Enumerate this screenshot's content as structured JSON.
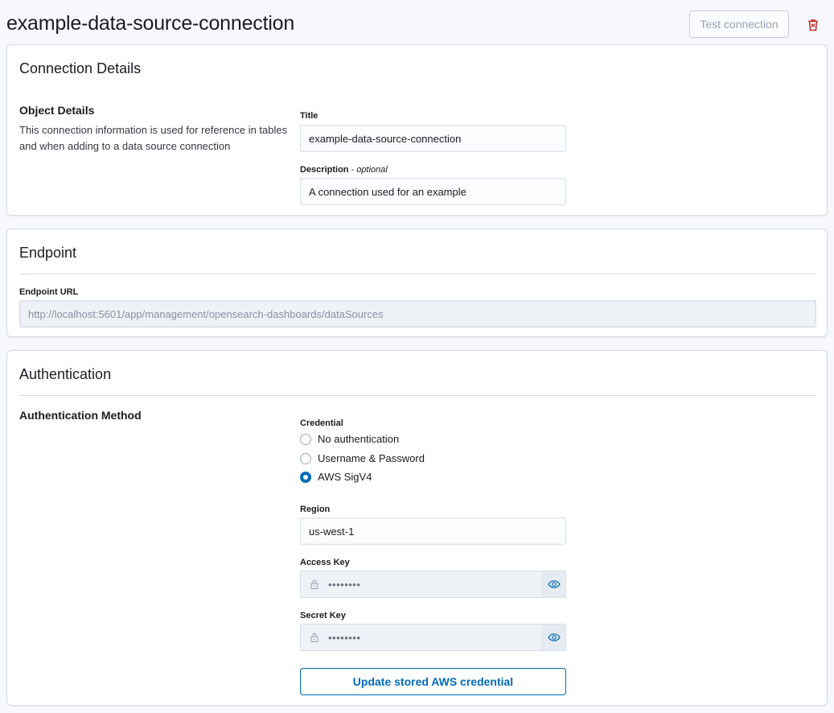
{
  "header": {
    "title": "example-data-source-connection",
    "test_button": "Test connection",
    "delete_icon": "trash-icon",
    "delete_color": "#bd271e"
  },
  "connection_details": {
    "heading": "Connection Details",
    "object_details_title": "Object Details",
    "object_details_desc": "This connection information is used for reference in tables and when adding to a data source connection",
    "title_label": "Title",
    "title_value": "example-data-source-connection",
    "description_label": "Description",
    "description_optional": "- optional",
    "description_value": "A connection used for an example"
  },
  "endpoint": {
    "heading": "Endpoint",
    "url_label": "Endpoint URL",
    "url_value": "http://localhost:5601/app/management/opensearch-dashboards/dataSources"
  },
  "authentication": {
    "heading": "Authentication",
    "method_title": "Authentication Method",
    "credential_label": "Credential",
    "options": [
      {
        "label": "No authentication",
        "selected": false
      },
      {
        "label": "Username & Password",
        "selected": false
      },
      {
        "label": "AWS SigV4",
        "selected": true
      }
    ],
    "region_label": "Region",
    "region_value": "us-west-1",
    "access_key_label": "Access Key",
    "access_key_value": "••••••••",
    "secret_key_label": "Secret Key",
    "secret_key_value": "••••••••",
    "update_button": "Update stored AWS credential"
  },
  "colors": {
    "accent": "#006bb8",
    "danger": "#bd271e",
    "border": "#d3dae6"
  }
}
